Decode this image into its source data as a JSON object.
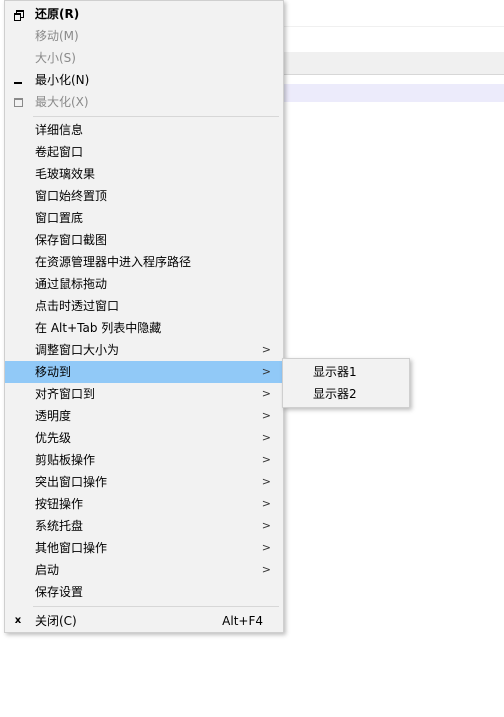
{
  "menu": {
    "items": [
      {
        "label": "还原(R)"
      },
      {
        "label": "移动(M)"
      },
      {
        "label": "大小(S)"
      },
      {
        "label": "最小化(N)"
      },
      {
        "label": "最大化(X)"
      },
      {
        "label": "详细信息"
      },
      {
        "label": "卷起窗口"
      },
      {
        "label": "毛玻璃效果"
      },
      {
        "label": "窗口始终置顶"
      },
      {
        "label": "窗口置底"
      },
      {
        "label": "保存窗口截图"
      },
      {
        "label": "在资源管理器中进入程序路径"
      },
      {
        "label": "通过鼠标拖动"
      },
      {
        "label": "点击时透过窗口"
      },
      {
        "label": "在 Alt+Tab 列表中隐藏"
      },
      {
        "label": "调整窗口大小为"
      },
      {
        "label": "移动到"
      },
      {
        "label": "对齐窗口到"
      },
      {
        "label": "透明度"
      },
      {
        "label": "优先级"
      },
      {
        "label": "剪贴板操作"
      },
      {
        "label": "突出窗口操作"
      },
      {
        "label": "按钮操作"
      },
      {
        "label": "系统托盘"
      },
      {
        "label": "其他窗口操作"
      },
      {
        "label": "启动"
      },
      {
        "label": "保存设置"
      },
      {
        "label": "关闭(C)",
        "shortcut": "Alt+F4"
      }
    ],
    "submenu_arrow": ">",
    "close_icon_glyph": "x"
  },
  "submenu": {
    "items": [
      {
        "label": "显示器1"
      },
      {
        "label": "显示器2"
      }
    ]
  },
  "colors": {
    "menu_bg": "#f2f2f2",
    "hover_bg": "#91c9f7",
    "disabled_text": "#8a8a8a"
  }
}
